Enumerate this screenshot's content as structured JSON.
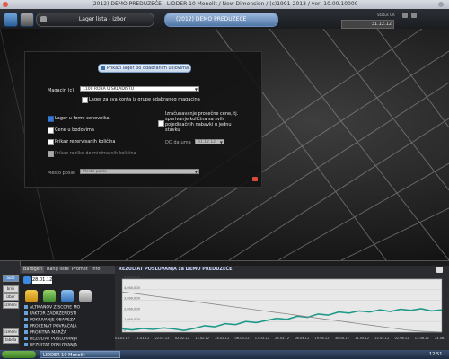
{
  "window": {
    "title": "(2012) DEMO PREDUZEĆE - LIDDER 10 Monolit / New Dimension / (c)1991-2013 / ver: 10.00.10000"
  },
  "toolbar": {
    "tab_active": "Lager lista - izbor",
    "tab_company": "(2012) DEMO PREDUZEĆE",
    "status_label": "Status OK",
    "status_date": "31.12.12"
  },
  "form": {
    "report_button": "Prikaži lager po odabranim uslovima",
    "magacin_label": "Magacin (c)",
    "magacin_value": "1100 ROBA U SKLADIŠTU",
    "group_checkbox_label": "Lager za sva konta iz grupe odabranog magacina",
    "left_options": [
      {
        "label": "Lager u formi cenovnika",
        "checked": true,
        "enabled": true
      },
      {
        "label": "Cene u bodovima",
        "checked": false,
        "enabled": true
      },
      {
        "label": "Prikaz rezervisanih količina",
        "checked": false,
        "enabled": true
      },
      {
        "label": "Prikaz razlike do minimalnih količina",
        "checked": false,
        "enabled": false
      }
    ],
    "avg_price_label": "Izračunavanje prosečne cene, tj. sparivanje količina sa svih pojedinačnih nabavki u jednu stavku",
    "do_datuma_label": "DO datuma",
    "do_datuma_value": "31.12.12",
    "mesto_label": "Mesto posle:",
    "mesto_value": "Mesto posla"
  },
  "bottom": {
    "side_buttons": [
      "auto",
      "brisi",
      "izbor",
      "izmeni",
      "izmeni",
      "tabela"
    ],
    "tabs": [
      "Bardgen",
      "Rang liste",
      "Promet",
      "info"
    ],
    "kpi_date": "28.01.12",
    "kpi_items": [
      "ALTMANOV Z-SCORE MO",
      "FAKTOR ZADUŽENOSTI",
      "POKRIVANJE OBAVEZA",
      "PROCENAT POVRAĆAJA",
      "PROFITNA MARŽA",
      "REZULTAT POSLOVANJA",
      "REZULTAT POSLOVANJA",
      "STOPA POSLOVNOG"
    ],
    "taskbar_item": "LIDDER 10 Monolit",
    "clock": "12:51"
  },
  "chart_data": {
    "type": "line",
    "title": "REZULTAT POSLOVANJA za DEMO PREDUZEĆE",
    "ylim": [
      0,
      5000000
    ],
    "y_ticks": [
      "5,000,000",
      "4,000,000",
      "3,000,000",
      "2,000,000",
      "1,000,000",
      "0"
    ],
    "x_ticks": [
      "01.01.12",
      "11.01.12",
      "22.01.12",
      "02.02.12",
      "13.02.12",
      "24.02.12",
      "06.03.12",
      "17.03.12",
      "28.03.12",
      "08.04.12",
      "19.04.12",
      "30.04.12",
      "11.05.12",
      "22.05.12",
      "02.06.12",
      "13.06.12",
      "24.06.12"
    ],
    "series": [
      {
        "values": [
          300000,
          200000,
          350000,
          250000,
          400000,
          300000,
          150000,
          350000,
          600000,
          500000,
          800000,
          700000,
          1000000,
          900000,
          1100000,
          1300000,
          1200000,
          1500000,
          1400000,
          1700000,
          1600000,
          1900000,
          1800000,
          2000000,
          1900000,
          2100000,
          1950000,
          2150000,
          2050000,
          2200000,
          2000000,
          2100000
        ]
      },
      {
        "values": [
          3800000,
          3650000,
          3500000,
          3350000,
          3200000,
          3050000,
          2900000,
          2750000,
          2600000,
          2450000,
          2300000,
          2150000,
          2000000,
          1850000,
          1700000,
          1550000,
          1400000,
          1250000,
          1100000,
          950000,
          800000,
          650000,
          500000,
          350000,
          200000,
          100000,
          50000,
          0
        ]
      }
    ]
  }
}
